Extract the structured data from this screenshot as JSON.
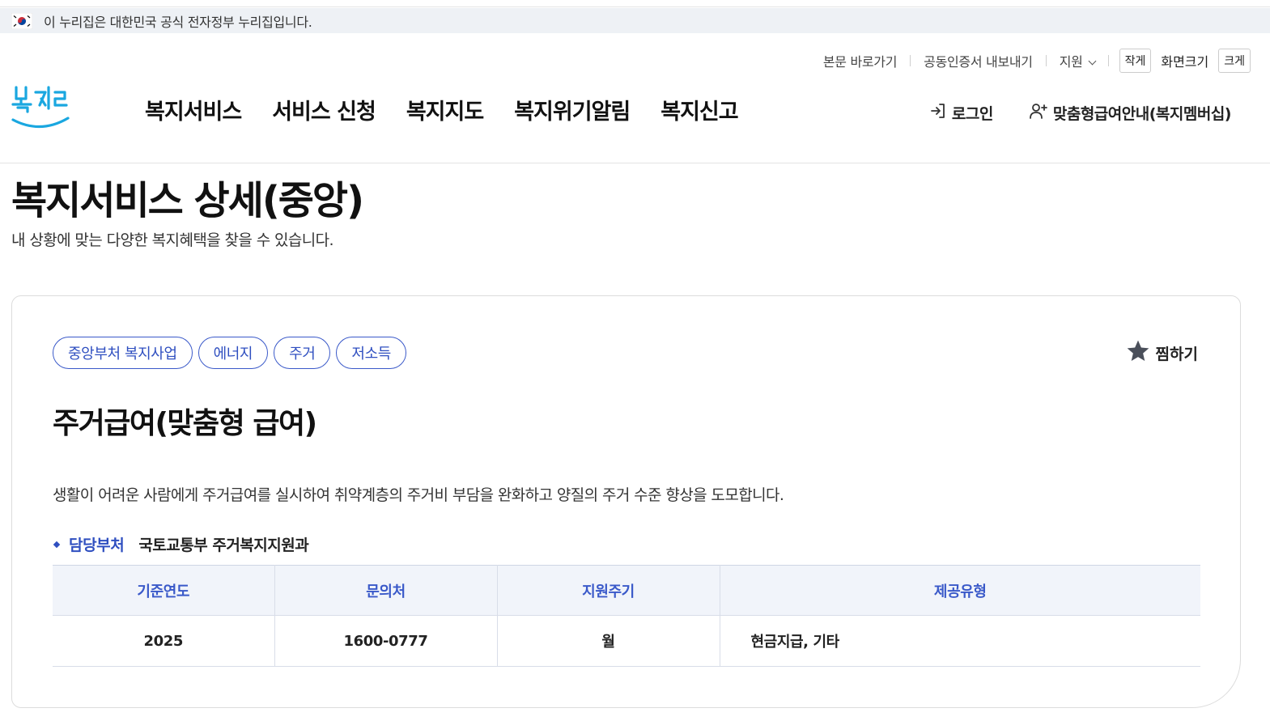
{
  "gov_banner": {
    "text": "이 누리집은 대한민국 공식 전자정부 누리집입니다.",
    "flag_icon": "korea-flag-icon"
  },
  "utility": {
    "skip_link": "본문 바로가기",
    "cert_export": "공동인증서 내보내기",
    "support": "지원",
    "size_small": "작게",
    "size_label": "화면크기",
    "size_large": "크게"
  },
  "logo": {
    "text": "복지로"
  },
  "gnb": [
    "복지서비스",
    "서비스 신청",
    "복지지도",
    "복지위기알림",
    "복지신고"
  ],
  "auth": {
    "login": "로그인",
    "membership": "맞춤형급여안내(복지멤버십)"
  },
  "page": {
    "title": "복지서비스 상세(중앙)",
    "description": "내 상황에 맞는 다양한 복지혜택을 찾을 수 있습니다."
  },
  "service": {
    "tags": [
      "중앙부처 복지사업",
      "에너지",
      "주거",
      "저소득"
    ],
    "favorite_label": "찜하기",
    "title": "주거급여(맞춤형 급여)",
    "description": "생활이 어려운 사람에게 주거급여를 실시하여 취약계층의 주거비 부담을 완화하고 양질의 주거 수준 향상을 도모합니다.",
    "dept_label": "담당부처",
    "dept_value": "국토교통부 주거복지지원과",
    "table": {
      "headers": [
        "기준연도",
        "문의처",
        "지원주기",
        "제공유형"
      ],
      "row": [
        "2025",
        "1600-0777",
        "월",
        "현금지급, 기타"
      ]
    }
  },
  "colors": {
    "accent": "#2f4fc0",
    "banner_bg": "#eef1f5",
    "table_header_bg": "#f1f4fa",
    "logo_blue": "#1aa7e0"
  }
}
